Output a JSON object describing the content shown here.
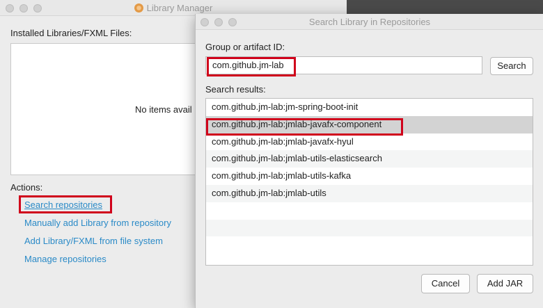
{
  "library_manager": {
    "title": "Library Manager",
    "installed_label": "Installed Libraries/FXML Files:",
    "empty_text": "No items avail",
    "actions_label": "Actions:",
    "actions": [
      "Search repositories",
      "Manually add Library from repository",
      "Add Library/FXML from file system",
      "Manage repositories"
    ]
  },
  "search_dialog": {
    "title": "Search Library in Repositories",
    "group_label": "Group or artifact ID:",
    "query": "com.github.jm-lab",
    "search_button": "Search",
    "results_label": "Search results:",
    "results": [
      "com.github.jm-lab:jm-spring-boot-init",
      "com.github.jm-lab:jmlab-javafx-component",
      "com.github.jm-lab:jmlab-javafx-hyul",
      "com.github.jm-lab:jmlab-utils-elasticsearch",
      "com.github.jm-lab:jmlab-utils-kafka",
      "com.github.jm-lab:jmlab-utils",
      "",
      "",
      ""
    ],
    "selected_index": 1,
    "cancel_button": "Cancel",
    "add_jar_button": "Add JAR"
  },
  "colors": {
    "link": "#2a8ac7",
    "highlight": "#d0021b",
    "selected_row": "#d3d3d3"
  }
}
